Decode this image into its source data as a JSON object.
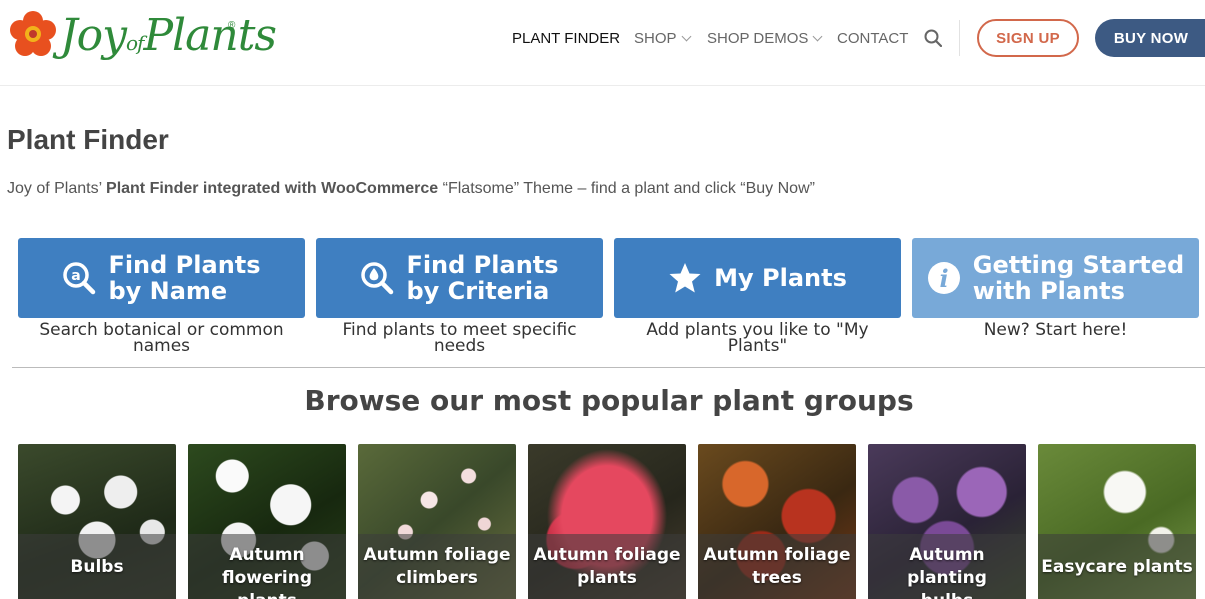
{
  "brand": {
    "logo_text_main": "Joy",
    "logo_text_small": "of",
    "logo_text_end": "Plants",
    "reg": "®",
    "color_green": "#2f8a3a",
    "color_flower": "#e8501f"
  },
  "nav": {
    "plant_finder": "PLANT FINDER",
    "shop": "SHOP",
    "shop_demos": "SHOP DEMOS",
    "contact": "CONTACT",
    "sign_up": "SIGN UP",
    "buy_now": "BUY NOW"
  },
  "page": {
    "title": "Plant Finder",
    "intro_prefix": "Joy of Plants’ ",
    "intro_bold": "Plant Finder integrated with WooCommerce",
    "intro_suffix": " “Flatsome” Theme – find a plant and click “Buy Now”"
  },
  "actions": [
    {
      "label_line1": "Find Plants",
      "label_line2": "by Name",
      "icon": "search-by-name-icon",
      "caption": "Search botanical or common names"
    },
    {
      "label_line1": "Find Plants",
      "label_line2": "by Criteria",
      "icon": "search-by-criteria-icon",
      "caption": "Find plants to meet specific needs"
    },
    {
      "label_line1": "My Plants",
      "label_line2": "",
      "icon": "star-icon",
      "caption": "Add plants you like to \"My Plants\""
    },
    {
      "label_line1": "Getting Started",
      "label_line2": "with Plants",
      "icon": "info-icon",
      "caption": "New? Start here!"
    }
  ],
  "browse": {
    "title": "Browse our most popular plant groups",
    "groups": [
      {
        "line1": "Bulbs",
        "line2": ""
      },
      {
        "line1": "Autumn flowering",
        "line2": "plants"
      },
      {
        "line1": "Autumn foliage",
        "line2": "climbers"
      },
      {
        "line1": "Autumn foliage",
        "line2": "plants"
      },
      {
        "line1": "Autumn foliage",
        "line2": "trees"
      },
      {
        "line1": "Autumn planting",
        "line2": "bulbs"
      },
      {
        "line1": "Easycare plants",
        "line2": ""
      }
    ]
  },
  "colors": {
    "primary_blue": "#3f7fc1",
    "light_blue": "#78a9d8",
    "navy": "#3d5a83",
    "orange": "#d2684b"
  }
}
